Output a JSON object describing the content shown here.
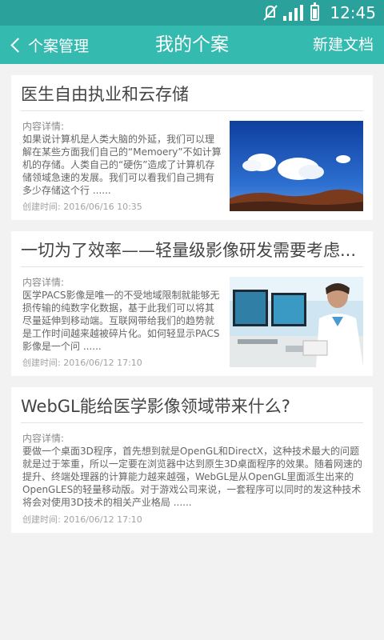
{
  "status_bar": {
    "time": "12:45",
    "icons": [
      "mute-icon",
      "signal-icon",
      "battery-icon"
    ]
  },
  "app_bar": {
    "back_label": "个案管理",
    "title": "我的个案",
    "action_label": "新建文档",
    "color": "#35bab0"
  },
  "cards": [
    {
      "title": "医生自由执业和云存储",
      "detail_label": "内容详情:",
      "body": "如果说计算机是人类大脑的外延，我们可以理解在某些方面我们自己的“Memoery”不如计算机的存储。人类自己的“硬伤”造成了计算机存储领域急速的发展。我们可以看我们自己拥有多少存储这个行 ......",
      "created": "创建时间:  2016/06/16  10:35",
      "image": "sky-mountain-landscape"
    },
    {
      "title": "一切为了效率——轻量级影像研发需要考虑...",
      "detail_label": "内容详情:",
      "body": "医学PACS影像是唯一的不受地域限制就能够无损传输的纯数字化数据，基于此我们可以将其尽量延伸到移动端。互联网带给我们的趋势就是工作时间越来越被碎片化。如何轻显示PACS影像是一个问 ......",
      "created": "创建时间:  2016/06/12  17:10",
      "image": "doctor-at-monitors"
    },
    {
      "title": "WebGL能给医学影像领域带来什么?",
      "detail_label": "内容详情:",
      "body": "要做一个桌面3D程序，首先想到就是OpenGL和DirectX，这种技术最大的问题就是过于笨重，所以一定要在浏览器中达到原生3D桌面程序的效果。随着网速的提升、终端处理器的计算能力越来越强，WebGL是从OpenGL里面派生出来的OpenGLES的轻量移动版。对于游戏公司来说，一套程序可以同时的发这种技术将会对使用3D技术的相关产业格局 ......",
      "created": "创建时间:  2016/06/12  17:10"
    }
  ]
}
